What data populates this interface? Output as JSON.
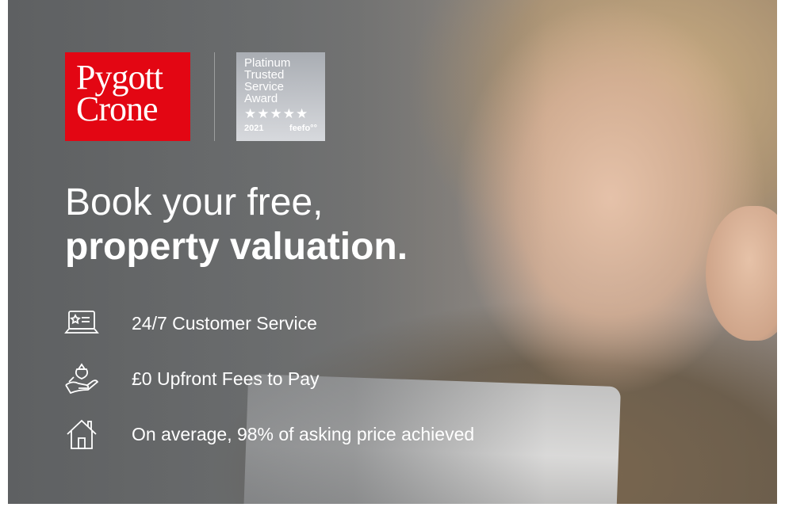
{
  "brand": {
    "logo_line1": "Pygott",
    "logo_line2": "Crone",
    "color": "#e30613"
  },
  "award": {
    "line1": "Platinum",
    "line2": "Trusted",
    "line3": "Service",
    "line4": "Award",
    "stars": "★★★★★",
    "year": "2021",
    "provider": "feefo°°"
  },
  "headline": {
    "line1": "Book your free,",
    "line2": "property valuation."
  },
  "features": [
    {
      "icon": "laptop-star-icon",
      "text": "24/7 Customer Service"
    },
    {
      "icon": "hand-money-icon",
      "text": "£0 Upfront Fees to Pay"
    },
    {
      "icon": "house-icon",
      "text": "On average, 98% of asking price achieved"
    }
  ]
}
